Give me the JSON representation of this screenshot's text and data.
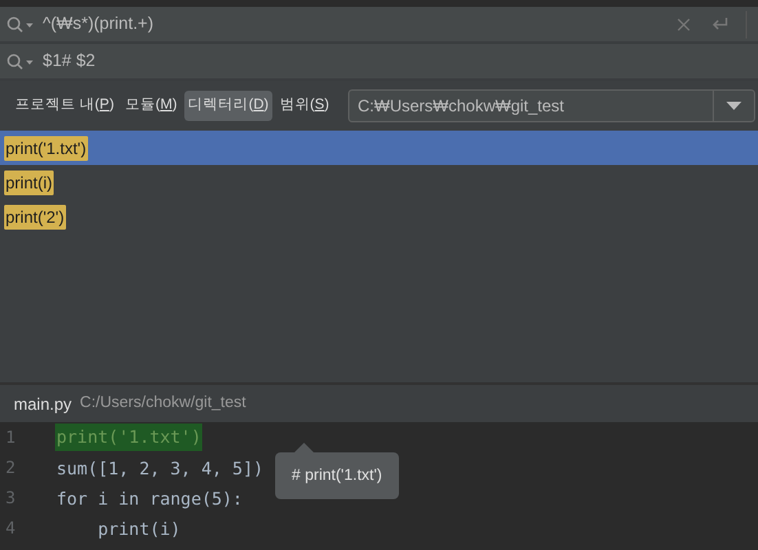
{
  "search": {
    "value": "^(₩s*)(print.+)"
  },
  "replace": {
    "value": "$1# $2"
  },
  "scopes": [
    {
      "label": "프로젝트 내(P)",
      "selected": false
    },
    {
      "label": "모듈(M)",
      "selected": false
    },
    {
      "label": "디렉터리(D)",
      "selected": true
    },
    {
      "label": "범위(S)",
      "selected": false
    }
  ],
  "directory": {
    "value": "C:₩Users₩chokw₩git_test"
  },
  "results": [
    {
      "text": "print('1.txt')",
      "selected": true
    },
    {
      "text": "print(i)",
      "selected": false
    },
    {
      "text": "print('2')",
      "selected": false
    }
  ],
  "preview": {
    "file": "main.py",
    "path": "C:/Users/chokw/git_test",
    "lines": [
      {
        "number": "1",
        "code": "print('1.txt')",
        "matched": true
      },
      {
        "number": "2",
        "code": "sum([1, 2, 3, 4, 5])",
        "matched": false
      },
      {
        "number": "3",
        "code": "for i in range(5):",
        "matched": false
      },
      {
        "number": "4",
        "code": "    print(i)",
        "matched": false
      }
    ],
    "tooltip": "# print('1.txt')"
  }
}
